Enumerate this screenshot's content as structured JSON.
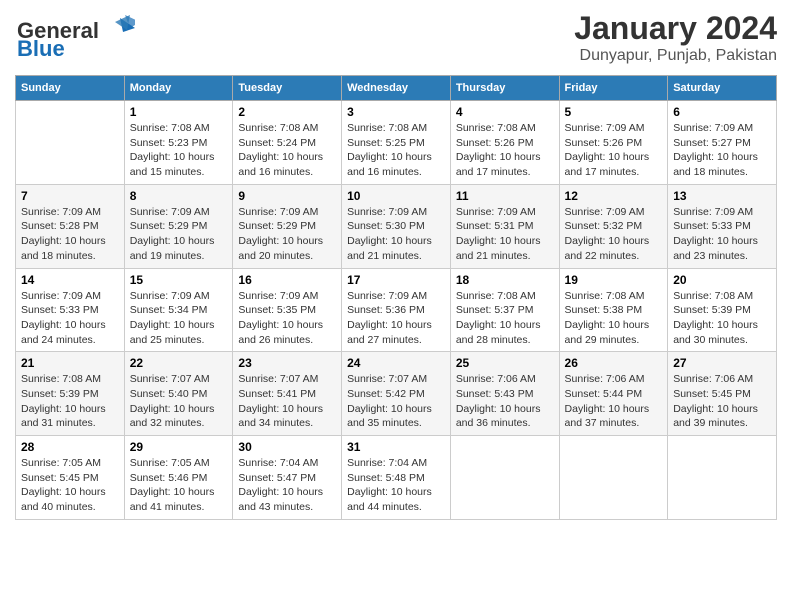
{
  "header": {
    "logo_general": "General",
    "logo_blue": "Blue",
    "main_title": "January 2024",
    "subtitle": "Dunyapur, Punjab, Pakistan"
  },
  "calendar": {
    "days_of_week": [
      "Sunday",
      "Monday",
      "Tuesday",
      "Wednesday",
      "Thursday",
      "Friday",
      "Saturday"
    ],
    "weeks": [
      [
        {
          "day": "",
          "info": ""
        },
        {
          "day": "1",
          "info": "Sunrise: 7:08 AM\nSunset: 5:23 PM\nDaylight: 10 hours\nand 15 minutes."
        },
        {
          "day": "2",
          "info": "Sunrise: 7:08 AM\nSunset: 5:24 PM\nDaylight: 10 hours\nand 16 minutes."
        },
        {
          "day": "3",
          "info": "Sunrise: 7:08 AM\nSunset: 5:25 PM\nDaylight: 10 hours\nand 16 minutes."
        },
        {
          "day": "4",
          "info": "Sunrise: 7:08 AM\nSunset: 5:26 PM\nDaylight: 10 hours\nand 17 minutes."
        },
        {
          "day": "5",
          "info": "Sunrise: 7:09 AM\nSunset: 5:26 PM\nDaylight: 10 hours\nand 17 minutes."
        },
        {
          "day": "6",
          "info": "Sunrise: 7:09 AM\nSunset: 5:27 PM\nDaylight: 10 hours\nand 18 minutes."
        }
      ],
      [
        {
          "day": "7",
          "info": "Sunrise: 7:09 AM\nSunset: 5:28 PM\nDaylight: 10 hours\nand 18 minutes."
        },
        {
          "day": "8",
          "info": "Sunrise: 7:09 AM\nSunset: 5:29 PM\nDaylight: 10 hours\nand 19 minutes."
        },
        {
          "day": "9",
          "info": "Sunrise: 7:09 AM\nSunset: 5:29 PM\nDaylight: 10 hours\nand 20 minutes."
        },
        {
          "day": "10",
          "info": "Sunrise: 7:09 AM\nSunset: 5:30 PM\nDaylight: 10 hours\nand 21 minutes."
        },
        {
          "day": "11",
          "info": "Sunrise: 7:09 AM\nSunset: 5:31 PM\nDaylight: 10 hours\nand 21 minutes."
        },
        {
          "day": "12",
          "info": "Sunrise: 7:09 AM\nSunset: 5:32 PM\nDaylight: 10 hours\nand 22 minutes."
        },
        {
          "day": "13",
          "info": "Sunrise: 7:09 AM\nSunset: 5:33 PM\nDaylight: 10 hours\nand 23 minutes."
        }
      ],
      [
        {
          "day": "14",
          "info": "Sunrise: 7:09 AM\nSunset: 5:33 PM\nDaylight: 10 hours\nand 24 minutes."
        },
        {
          "day": "15",
          "info": "Sunrise: 7:09 AM\nSunset: 5:34 PM\nDaylight: 10 hours\nand 25 minutes."
        },
        {
          "day": "16",
          "info": "Sunrise: 7:09 AM\nSunset: 5:35 PM\nDaylight: 10 hours\nand 26 minutes."
        },
        {
          "day": "17",
          "info": "Sunrise: 7:09 AM\nSunset: 5:36 PM\nDaylight: 10 hours\nand 27 minutes."
        },
        {
          "day": "18",
          "info": "Sunrise: 7:08 AM\nSunset: 5:37 PM\nDaylight: 10 hours\nand 28 minutes."
        },
        {
          "day": "19",
          "info": "Sunrise: 7:08 AM\nSunset: 5:38 PM\nDaylight: 10 hours\nand 29 minutes."
        },
        {
          "day": "20",
          "info": "Sunrise: 7:08 AM\nSunset: 5:39 PM\nDaylight: 10 hours\nand 30 minutes."
        }
      ],
      [
        {
          "day": "21",
          "info": "Sunrise: 7:08 AM\nSunset: 5:39 PM\nDaylight: 10 hours\nand 31 minutes."
        },
        {
          "day": "22",
          "info": "Sunrise: 7:07 AM\nSunset: 5:40 PM\nDaylight: 10 hours\nand 32 minutes."
        },
        {
          "day": "23",
          "info": "Sunrise: 7:07 AM\nSunset: 5:41 PM\nDaylight: 10 hours\nand 34 minutes."
        },
        {
          "day": "24",
          "info": "Sunrise: 7:07 AM\nSunset: 5:42 PM\nDaylight: 10 hours\nand 35 minutes."
        },
        {
          "day": "25",
          "info": "Sunrise: 7:06 AM\nSunset: 5:43 PM\nDaylight: 10 hours\nand 36 minutes."
        },
        {
          "day": "26",
          "info": "Sunrise: 7:06 AM\nSunset: 5:44 PM\nDaylight: 10 hours\nand 37 minutes."
        },
        {
          "day": "27",
          "info": "Sunrise: 7:06 AM\nSunset: 5:45 PM\nDaylight: 10 hours\nand 39 minutes."
        }
      ],
      [
        {
          "day": "28",
          "info": "Sunrise: 7:05 AM\nSunset: 5:45 PM\nDaylight: 10 hours\nand 40 minutes."
        },
        {
          "day": "29",
          "info": "Sunrise: 7:05 AM\nSunset: 5:46 PM\nDaylight: 10 hours\nand 41 minutes."
        },
        {
          "day": "30",
          "info": "Sunrise: 7:04 AM\nSunset: 5:47 PM\nDaylight: 10 hours\nand 43 minutes."
        },
        {
          "day": "31",
          "info": "Sunrise: 7:04 AM\nSunset: 5:48 PM\nDaylight: 10 hours\nand 44 minutes."
        },
        {
          "day": "",
          "info": ""
        },
        {
          "day": "",
          "info": ""
        },
        {
          "day": "",
          "info": ""
        }
      ]
    ]
  }
}
